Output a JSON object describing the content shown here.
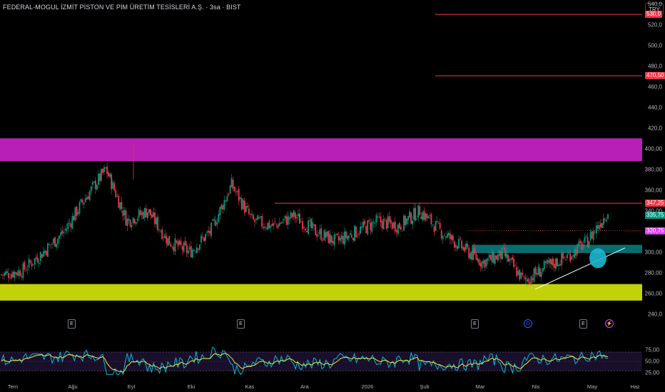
{
  "header": {
    "title": "FEDERAL-MOGUL İZMİT PİSTON VE PİM ÜRETİM TESİSLERİ A.Ş. · 3sa · BIST",
    "currency_button": "TRY"
  },
  "price_axis": {
    "ticks": [
      "540,0",
      "520,0",
      "500,0",
      "480,0",
      "460,0",
      "440,0",
      "420,0",
      "400,00",
      "380,00",
      "360,00",
      "340,00",
      "300,00",
      "280,00",
      "260,00",
      "240,0"
    ],
    "tick_values": [
      540,
      520,
      500,
      480,
      460,
      440,
      420,
      400,
      380,
      360,
      340,
      300,
      280,
      260,
      240
    ]
  },
  "price_labels": [
    {
      "text": "530,0",
      "value": 530,
      "color": "#f23645"
    },
    {
      "text": "470,50",
      "value": 470.5,
      "color": "#f23645"
    },
    {
      "text": "347,25",
      "value": 347.25,
      "color": "#f23645"
    },
    {
      "text": "335,75",
      "value": 335.75,
      "color": "#089981"
    },
    {
      "text": "320,75",
      "value": 320.75,
      "color": "#e040fb"
    }
  ],
  "levels": {
    "resistance_lines": [
      530,
      470.5
    ],
    "horizontal_347": 347.25,
    "dotted_320": 320.75
  },
  "zones": {
    "magenta": {
      "from": 388,
      "to": 410,
      "color": "#b71fb5"
    },
    "yellow": {
      "from": 253,
      "to": 269,
      "color": "#c3d10a"
    },
    "teal": {
      "from": 299,
      "to": 307,
      "color": "#0a7f84"
    }
  },
  "event_markers": [
    {
      "label": "E",
      "kind": "E"
    },
    {
      "label": "E",
      "kind": "E"
    },
    {
      "label": "E",
      "kind": "E"
    },
    {
      "label": "D",
      "kind": "D"
    },
    {
      "label": "E",
      "kind": "E"
    },
    {
      "label": "⚡",
      "kind": "S"
    }
  ],
  "time_axis": [
    "Tem",
    "Ağu",
    "Eyl",
    "Eki",
    "Kas",
    "Ara",
    "2026",
    "Şub",
    "Mar",
    "Nis",
    "May",
    "Haz"
  ],
  "oscillator": {
    "ticks": [
      "75,00",
      "50,00",
      "25,00"
    ],
    "tick_values": [
      75,
      50,
      25
    ],
    "upper": 70,
    "lower": 30
  },
  "colors": {
    "up": "#089981",
    "down": "#f23645",
    "rsi": "#00bcd4",
    "ma": "#f0e442",
    "trend": "#ffffff"
  },
  "chart_data": {
    "type": "candlestick",
    "title": "FEDERAL-MOGUL İZMİT PİSTON VE PİM ÜRETİM TESİSLERİ A.Ş. · 3sa · BIST",
    "ylim": [
      240,
      545
    ],
    "x_categories": [
      "Tem",
      "Ağu",
      "Eyl",
      "Eki",
      "Kas",
      "Ara",
      "2026",
      "Şub",
      "Mar",
      "Nis",
      "May",
      "Haz"
    ],
    "price_path": [
      [
        "Tem",
        278
      ],
      [
        "Tem",
        282
      ],
      [
        "Ağu",
        300
      ],
      [
        "Ağu",
        320
      ],
      [
        "Eyl",
        352
      ],
      [
        "Eyl",
        380
      ],
      [
        "Eyl",
        330
      ],
      [
        "Eki",
        340
      ],
      [
        "Eki",
        310
      ],
      [
        "Eki",
        300
      ],
      [
        "Kas",
        320
      ],
      [
        "Kas",
        365
      ],
      [
        "Kas",
        330
      ],
      [
        "Ara",
        325
      ],
      [
        "Ara",
        335
      ],
      [
        "Ara",
        320
      ],
      [
        "2026",
        310
      ],
      [
        "2026",
        320
      ],
      [
        "2026",
        330
      ],
      [
        "Şub",
        325
      ],
      [
        "Şub",
        340
      ],
      [
        "Şub",
        320
      ],
      [
        "Mar",
        305
      ],
      [
        "Mar",
        290
      ],
      [
        "Mar",
        298
      ],
      [
        "Nis",
        272
      ],
      [
        "Nis",
        285
      ],
      [
        "Nis",
        295
      ],
      [
        "May",
        310
      ],
      [
        "May",
        340
      ]
    ],
    "current_close": 335.75,
    "rsi_last": 65
  }
}
